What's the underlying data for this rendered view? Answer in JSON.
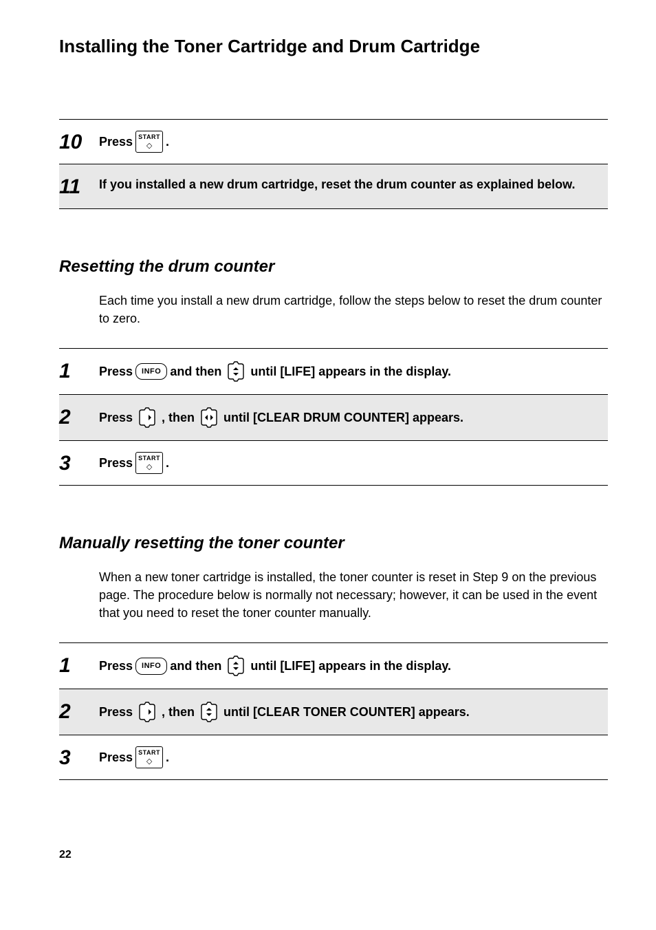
{
  "pageTitle": "Installing the Toner Cartridge and Drum Cartridge",
  "steps1": [
    {
      "num": "10",
      "parts": [
        {
          "t": "text",
          "v": "Press "
        },
        {
          "t": "start"
        },
        {
          "t": "text",
          "v": "."
        }
      ]
    },
    {
      "num": "11",
      "parts": [
        {
          "t": "text",
          "v": "If you installed a new drum cartridge, reset the drum counter as explained below."
        }
      ]
    }
  ],
  "section2": {
    "heading": "Resetting the drum counter",
    "body": "Each time you install a new drum cartridge, follow the steps below to reset the drum counter to zero.",
    "steps": [
      {
        "num": "1",
        "parts": [
          {
            "t": "text",
            "v": "Press "
          },
          {
            "t": "info"
          },
          {
            "t": "text",
            "v": " and then "
          },
          {
            "t": "nav",
            "dir": "ud"
          },
          {
            "t": "text",
            "v": " until [LIFE] appears in the display."
          }
        ]
      },
      {
        "num": "2",
        "parts": [
          {
            "t": "text",
            "v": "Press "
          },
          {
            "t": "nav",
            "dir": "r"
          },
          {
            "t": "text",
            "v": ", then "
          },
          {
            "t": "nav",
            "dir": "lr"
          },
          {
            "t": "text",
            "v": " until [CLEAR DRUM COUNTER] appears."
          }
        ]
      },
      {
        "num": "3",
        "parts": [
          {
            "t": "text",
            "v": "Press "
          },
          {
            "t": "start"
          },
          {
            "t": "text",
            "v": "."
          }
        ]
      }
    ]
  },
  "section3": {
    "heading": "Manually resetting the toner counter",
    "body": "When a new toner cartridge is installed, the toner counter is reset in Step 9 on the previous page. The procedure below is normally not necessary; however, it can be used in the event that you need to reset the toner counter manually.",
    "steps": [
      {
        "num": "1",
        "parts": [
          {
            "t": "text",
            "v": "Press "
          },
          {
            "t": "info"
          },
          {
            "t": "text",
            "v": " and then "
          },
          {
            "t": "nav",
            "dir": "ud"
          },
          {
            "t": "text",
            "v": " until [LIFE] appears in the display."
          }
        ]
      },
      {
        "num": "2",
        "parts": [
          {
            "t": "text",
            "v": "Press "
          },
          {
            "t": "nav",
            "dir": "r"
          },
          {
            "t": "text",
            "v": ", then "
          },
          {
            "t": "nav",
            "dir": "ud"
          },
          {
            "t": "text",
            "v": " until [CLEAR TONER COUNTER] appears."
          }
        ]
      },
      {
        "num": "3",
        "parts": [
          {
            "t": "text",
            "v": "Press "
          },
          {
            "t": "start"
          },
          {
            "t": "text",
            "v": "."
          }
        ]
      }
    ]
  },
  "labels": {
    "start": "START",
    "info": "INFO"
  },
  "pageNumber": "22"
}
